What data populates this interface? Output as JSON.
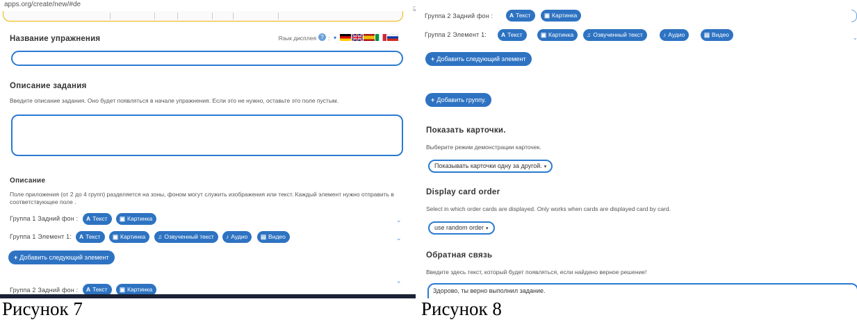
{
  "left": {
    "url": "apps.org/create/new/#de",
    "corner_mark": "☑",
    "exercise_title_label": "Название упражнения",
    "display_language_label": "Язык дисплея",
    "info_icon": "?",
    "lang_separator": ":",
    "lang_dropdown": "▾",
    "task_description_heading": "Описание задания",
    "task_description_hint": "Введите описание задания. Оно будет появляться в начале упражнения. Если это не нужно, оставьте это поле пустым.",
    "description_heading": "Описание",
    "description_hint": "Поле приложения (от 2 до 4 групп) разделяется на зоны, фоном могут служить изображения или текст. Каждый элемент нужно отправить в соответствующее поле .",
    "group1_bg_label": "Группа 1 Задний фон :",
    "group1_el_label": "Группа 1 Элемент 1:",
    "add_next_element": "Добавить следующий элемент",
    "group2_bg_label": "Группа 2 Задний фон :"
  },
  "buttons": {
    "text": "Текст",
    "picture": "Картинка",
    "voiced_text": "Озвученный текст",
    "audio": "Аудио",
    "video": "Видео",
    "add_icon": "+"
  },
  "icons": {
    "text_icon": "A",
    "picture_icon": "▣",
    "voiced_icon": "♫",
    "audio_icon": "♪",
    "video_icon": "▤",
    "chevron_down": "⌄",
    "chevron_up": "⌃"
  },
  "right": {
    "group2_bg_label": "Группа 2 Задний фон :",
    "group2_el_label": "Группа 2 Элемент 1:",
    "add_next_element": "Добавить следующий элемент",
    "add_group": "Добавить группу.",
    "show_cards_heading": "Показать карточки.",
    "show_cards_hint": "Выберите режим демонстрации карточек.",
    "show_cards_select": "Показывать карточки одну за другой.",
    "card_order_heading": "Display card order",
    "card_order_hint": "Select in which order cards are displayed. Only works when cards are displayed card by card.",
    "card_order_select": "use random order",
    "feedback_heading": "Обратная связь",
    "feedback_hint": "Введите здесь текст, который будет появляться, если найдено верное решение!",
    "feedback_value": "Здорово, ты верно выполнил задание."
  },
  "captions": {
    "fig7": "Рисунок 7",
    "fig8": "Рисунок 8"
  },
  "colors": {
    "accent": "#2e73c2",
    "field_border": "#2a7ad2",
    "url_highlight": "#f0b000"
  }
}
